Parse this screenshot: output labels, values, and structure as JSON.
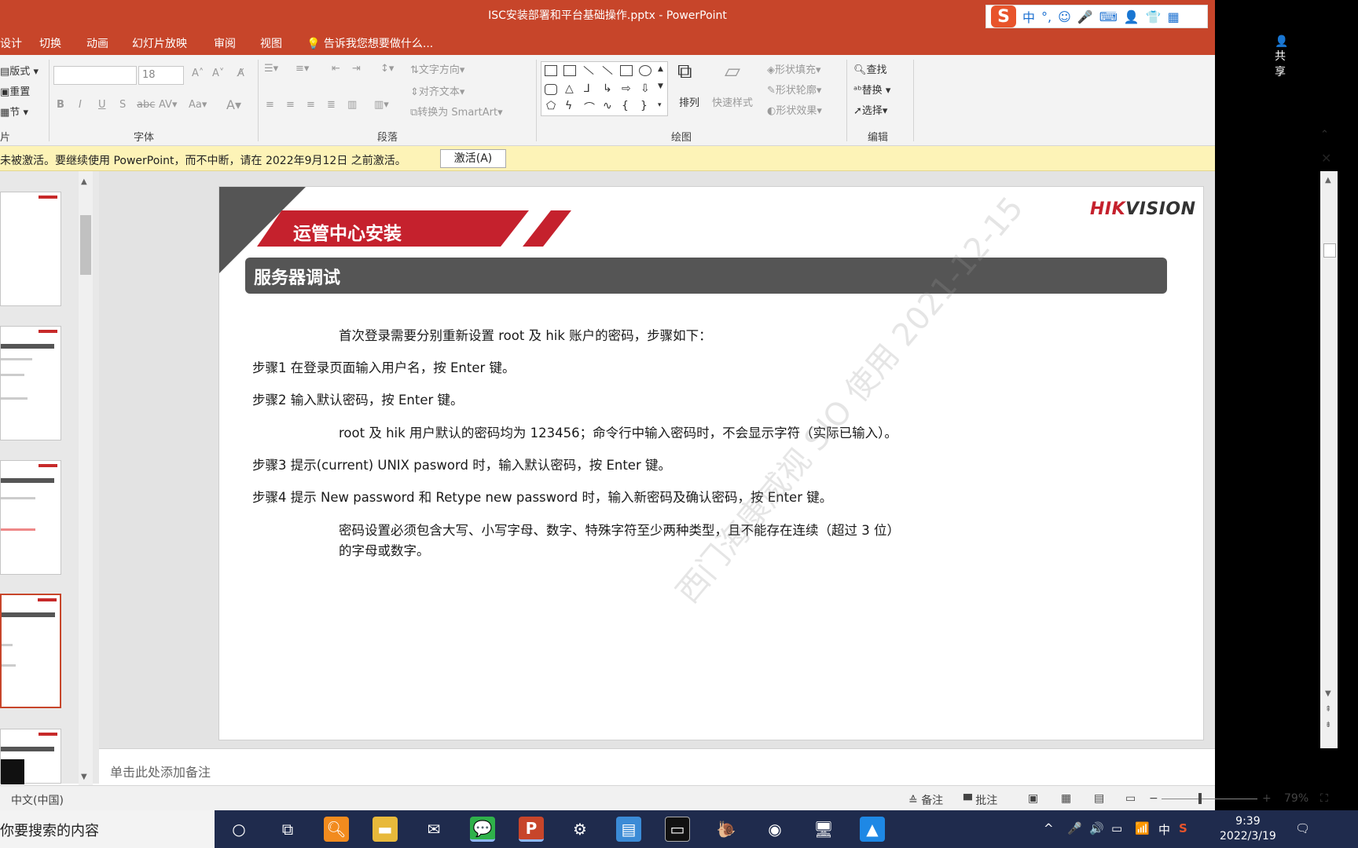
{
  "window": {
    "title": "ISC安装部署和平台基础操作.pptx - PowerPoint",
    "controls": {
      "minimize": "—",
      "restore": "❐",
      "close": "✕"
    }
  },
  "ime": {
    "logo": "S",
    "items": [
      "中",
      "°,",
      "☺",
      "🎤",
      "⌨",
      "👤",
      "👕",
      "▦"
    ]
  },
  "tabs": [
    "设计",
    "切换",
    "动画",
    "幻灯片放映",
    "审阅",
    "视图"
  ],
  "tell_me": "告诉我您想要做什么...",
  "share": "共享",
  "ribbon": {
    "slides_group": {
      "layout": "版式",
      "reset": "重置",
      "section": "节",
      "label": "片"
    },
    "font_group": {
      "font_size": "18",
      "label": "字体"
    },
    "paragraph_group": {
      "text_direction": "文字方向",
      "align_text": "对齐文本",
      "convert_smartart": "转换为 SmartArt",
      "label": "段落"
    },
    "drawing_group": {
      "arrange": "排列",
      "quick_styles": "快速样式",
      "shape_fill": "形状填充",
      "shape_outline": "形状轮廓",
      "shape_effects": "形状效果",
      "label": "绘图"
    },
    "editing_group": {
      "find": "查找",
      "replace": "替换",
      "select": "选择",
      "label": "编辑"
    }
  },
  "warning": {
    "message": "未被激活。要继续使用 PowerPoint，而不中断，请在 2022年9月12日 之前激活。",
    "activate_button": "激活(A)",
    "close": "✕"
  },
  "slide": {
    "banner_title": "运管中心安装",
    "logo": {
      "brand_red": "HIK",
      "brand_dark": "VISION"
    },
    "section_title": "服务器调试",
    "watermark": "西门海康威视 SIO 使用 2021-12-15",
    "lines": [
      "首次登录需要分别重新设置 root 及 hik 账户的密码，步骤如下：",
      "步骤1  在登录页面输入用户名，按 Enter 键。",
      "步骤2  输入默认密码，按 Enter 键。",
      "root 及 hik 用户默认的密码均为 123456；命令行中输入密码时，不会显示字符（实际已输入）。",
      "步骤3  提示(current) UNIX pasword 时，输入默认密码，按 Enter 键。",
      "步骤4  提示 New password 和 Retype new password 时，输入新密码及确认密码，按 Enter 键。",
      "密码设置必须包含大写、小写字母、数字、特殊字符至少两种类型，且不能存在连续（超过 3 位）",
      "的字母或数字。"
    ]
  },
  "notes_placeholder": "单击此处添加备注",
  "statusbar": {
    "language": "中文(中国)",
    "notes": "备注",
    "comments": "批注",
    "zoom_minus": "−",
    "zoom_plus": "+",
    "zoom": "79%",
    "zoom_level": 0.79
  },
  "taskbar": {
    "search_placeholder": "你要搜索的内容",
    "time": "9:39",
    "date": "2022/3/19",
    "ime_indicator": "中"
  },
  "colors": {
    "accent": "#c7452a",
    "slide_red": "#c5212d",
    "section_bar": "#555555",
    "warning_bg": "#fdf3b7",
    "taskbar": "#1f2b4d"
  }
}
